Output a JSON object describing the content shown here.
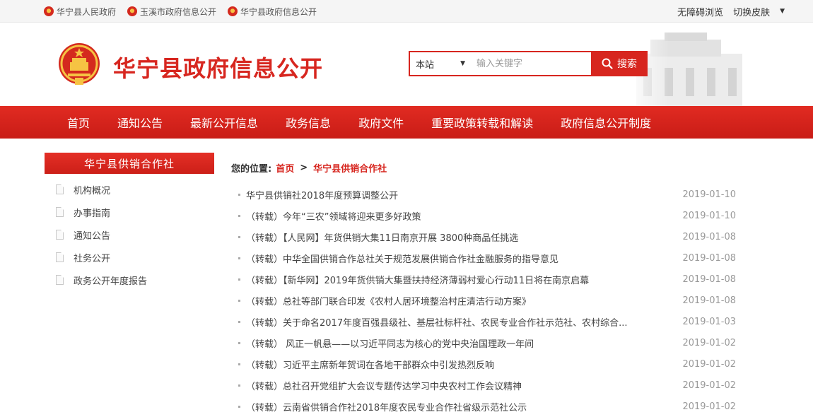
{
  "topbar": {
    "links": [
      "华宁县人民政府",
      "玉溪市政府信息公开",
      "华宁县政府信息公开"
    ],
    "accessibility": "无障碍浏览",
    "skin": "切换皮肤",
    "skin_caret": "▼"
  },
  "header": {
    "title": "华宁县政府信息公开",
    "search_scope": "本站",
    "search_scope_caret": "▼",
    "search_placeholder": "输入关键字",
    "search_button": "搜索"
  },
  "nav": [
    "首页",
    "通知公告",
    "最新公开信息",
    "政务信息",
    "政府文件",
    "重要政策转载和解读",
    "政府信息公开制度"
  ],
  "sidebar": {
    "title": "华宁县供销合作社",
    "items": [
      "机构概况",
      "办事指南",
      "通知公告",
      "社务公开",
      "政务公开年度报告"
    ]
  },
  "breadcrumb": {
    "label": "您的位置:",
    "home": "首页",
    "sep": ">",
    "current": "华宁县供销合作社"
  },
  "news": [
    {
      "title": "华宁县供销社2018年度预算调整公开",
      "date": "2019-01-10"
    },
    {
      "title": "（转载）今年“三农”领域将迎来更多好政策",
      "date": "2019-01-10"
    },
    {
      "title": "（转载）【人民网】年货供销大集11日南京开展 3800种商品任挑选",
      "date": "2019-01-08"
    },
    {
      "title": "（转载）中华全国供销合作总社关于规范发展供销合作社金融服务的指导意见",
      "date": "2019-01-08"
    },
    {
      "title": "（转载）【新华网】2019年货供销大集暨扶持经济薄弱村爱心行动11日将在南京启幕",
      "date": "2019-01-08"
    },
    {
      "title": "（转载）总社等部门联合印发《农村人居环境整治村庄清洁行动方案》",
      "date": "2019-01-08"
    },
    {
      "title": "（转载）关于命名2017年度百强县级社、基层社标杆社、农民专业合作社示范社、农村综合...",
      "date": "2019-01-03"
    },
    {
      "title": "（转载） 风正一帆悬——以习近平同志为核心的党中央治国理政一年间",
      "date": "2019-01-02"
    },
    {
      "title": "（转载）习近平主席新年贺词在各地干部群众中引发热烈反响",
      "date": "2019-01-02"
    },
    {
      "title": "（转载）总社召开党组扩大会议专题传达学习中央农村工作会议精神",
      "date": "2019-01-02"
    },
    {
      "title": "（转载）云南省供销合作社2018年度农民专业合作社省级示范社公示",
      "date": "2019-01-02"
    }
  ],
  "colors": {
    "brand_red": "#d7261f"
  },
  "icons": {
    "emblem": "national-emblem-icon",
    "search": "search-icon",
    "doc": "document-icon"
  }
}
